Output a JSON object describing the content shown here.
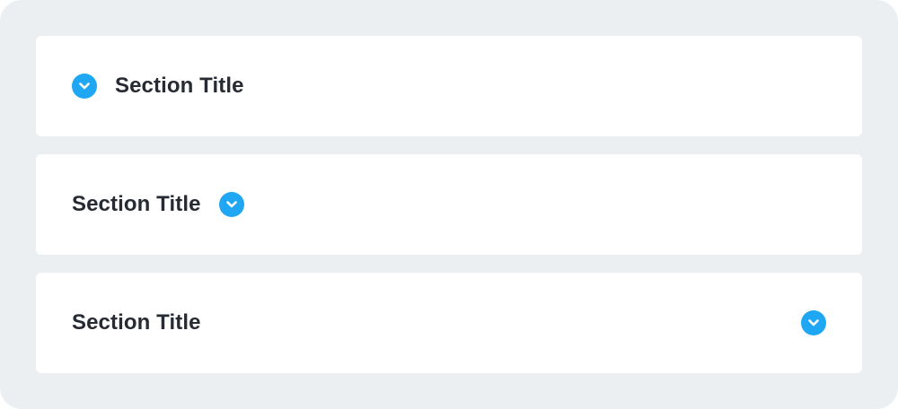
{
  "sections": [
    {
      "title": "Section Title",
      "icon": "chevron-down-icon"
    },
    {
      "title": "Section Title",
      "icon": "chevron-down-icon"
    },
    {
      "title": "Section Title",
      "icon": "chevron-down-icon"
    }
  ],
  "colors": {
    "background": "#ebeff2",
    "card": "#ffffff",
    "accent": "#1fa7f3",
    "text": "#262b33"
  }
}
